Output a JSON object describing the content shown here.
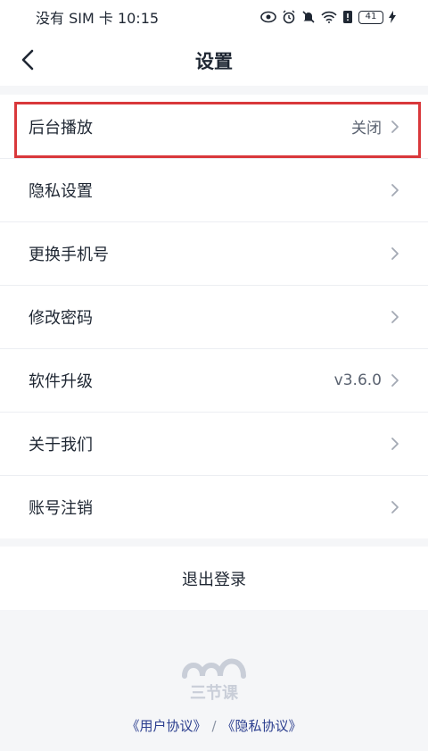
{
  "status_bar": {
    "carrier_time": "没有 SIM 卡 10:15",
    "battery": "41"
  },
  "header": {
    "title": "设置"
  },
  "settings": {
    "items": [
      {
        "label": "后台播放",
        "value": "关闭"
      },
      {
        "label": "隐私设置",
        "value": ""
      },
      {
        "label": "更换手机号",
        "value": ""
      },
      {
        "label": "修改密码",
        "value": ""
      },
      {
        "label": "软件升级",
        "value": "v3.6.0"
      },
      {
        "label": "关于我们",
        "value": ""
      },
      {
        "label": "账号注销",
        "value": ""
      }
    ]
  },
  "logout": {
    "label": "退出登录"
  },
  "footer": {
    "logo_text": "三节课",
    "user_agreement": "《用户协议》",
    "separator": "/",
    "privacy_agreement": "《隐私协议》"
  },
  "colors": {
    "highlight": "#d9383b",
    "link": "#2c3f8f",
    "logo": "#c9ced8"
  },
  "icons": [
    "back-arrow-icon",
    "chevron-right-icon",
    "eye-icon",
    "alarm-icon",
    "mute-icon",
    "wifi-icon",
    "battery-icon",
    "charging-icon"
  ]
}
